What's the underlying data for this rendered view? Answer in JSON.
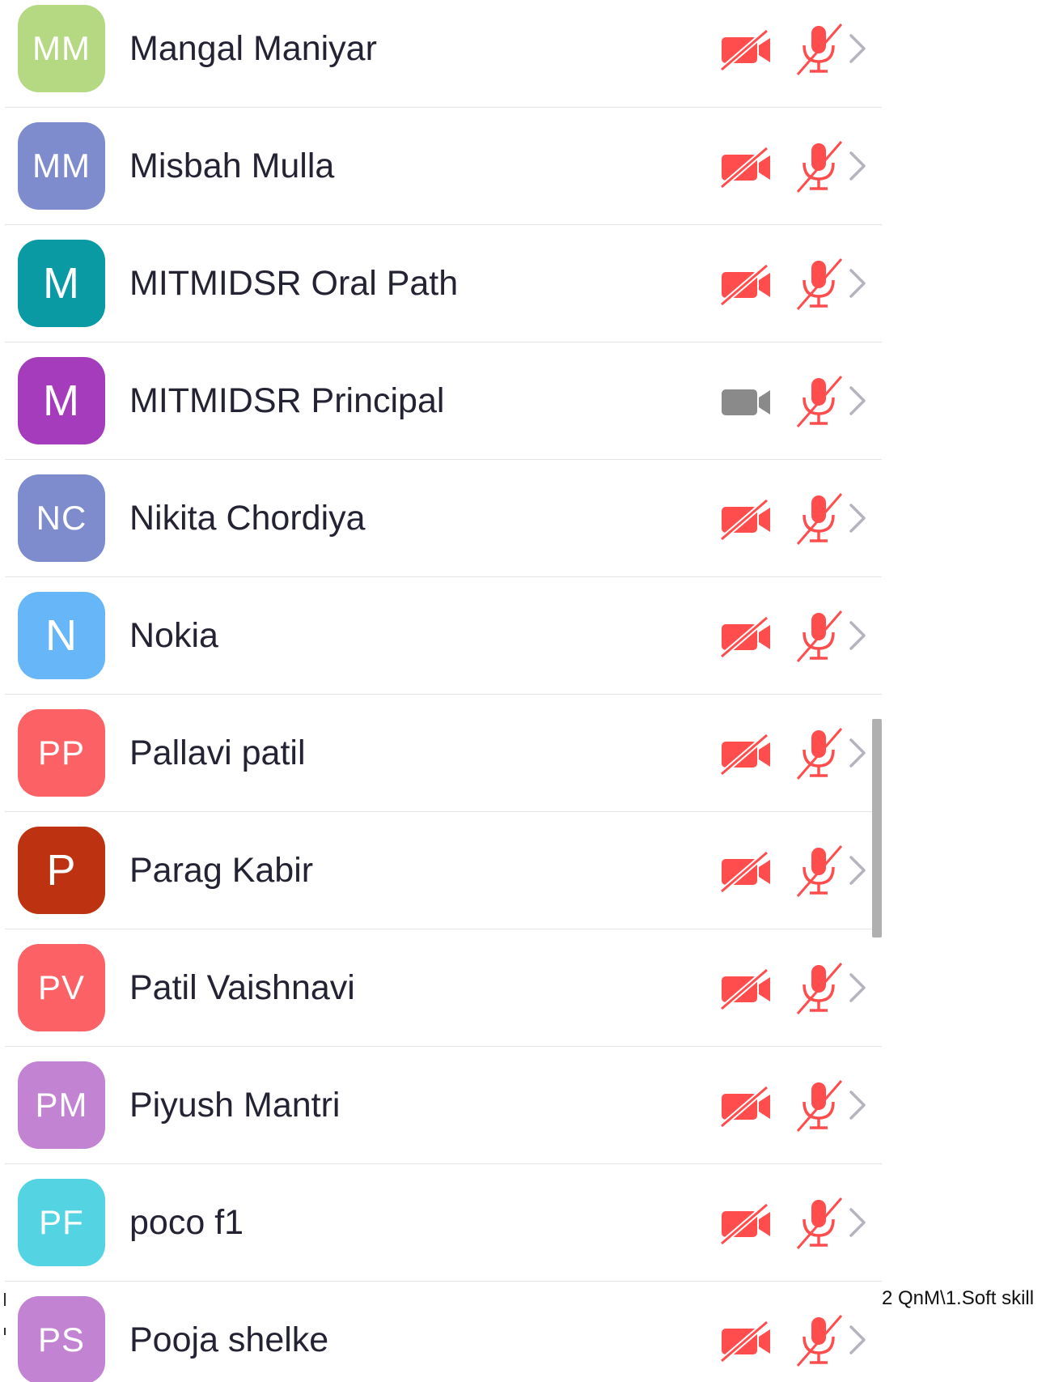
{
  "colors": {
    "muted_red": "#ff4d4d",
    "video_on_gray": "#8a8a8a",
    "chevron_gray": "#b4b4be",
    "name_text": "#232333",
    "divider": "#e4e4e6"
  },
  "participants": [
    {
      "initials": "MM",
      "name": "Mangal Maniyar",
      "avatar_color": "#b5d882",
      "video": "off",
      "audio": "muted"
    },
    {
      "initials": "MM",
      "name": "Misbah Mulla",
      "avatar_color": "#7e8ccd",
      "video": "off",
      "audio": "muted"
    },
    {
      "initials": "M",
      "name": "MITMIDSR Oral Path",
      "avatar_color": "#0a9aa3",
      "video": "off",
      "audio": "muted"
    },
    {
      "initials": "M",
      "name": "MITMIDSR Principal",
      "avatar_color": "#a53cbb",
      "video": "on",
      "audio": "muted"
    },
    {
      "initials": "NC",
      "name": "Nikita Chordiya",
      "avatar_color": "#7e8ccd",
      "video": "off",
      "audio": "muted"
    },
    {
      "initials": "N",
      "name": "Nokia",
      "avatar_color": "#67b6f7",
      "video": "off",
      "audio": "muted"
    },
    {
      "initials": "PP",
      "name": "Pallavi patil",
      "avatar_color": "#fc6265",
      "video": "off",
      "audio": "muted"
    },
    {
      "initials": "P",
      "name": "Parag Kabir",
      "avatar_color": "#bd3312",
      "video": "off",
      "audio": "muted"
    },
    {
      "initials": "PV",
      "name": "Patil Vaishnavi",
      "avatar_color": "#fc6265",
      "video": "off",
      "audio": "muted"
    },
    {
      "initials": "PM",
      "name": "Piyush Mantri",
      "avatar_color": "#c283d2",
      "video": "off",
      "audio": "muted"
    },
    {
      "initials": "PF",
      "name": "poco f1",
      "avatar_color": "#54d3e2",
      "video": "off",
      "audio": "muted"
    },
    {
      "initials": "PS",
      "name": "Pooja shelke",
      "avatar_color": "#c283d2",
      "video": "off",
      "audio": "muted"
    }
  ],
  "background_text": "2 QnM\\1.Soft skill",
  "icons": {
    "video_off": "video-camera-slash-icon",
    "video_on": "video-camera-icon",
    "mic_muted": "microphone-slash-icon",
    "chevron": "chevron-right-icon"
  }
}
